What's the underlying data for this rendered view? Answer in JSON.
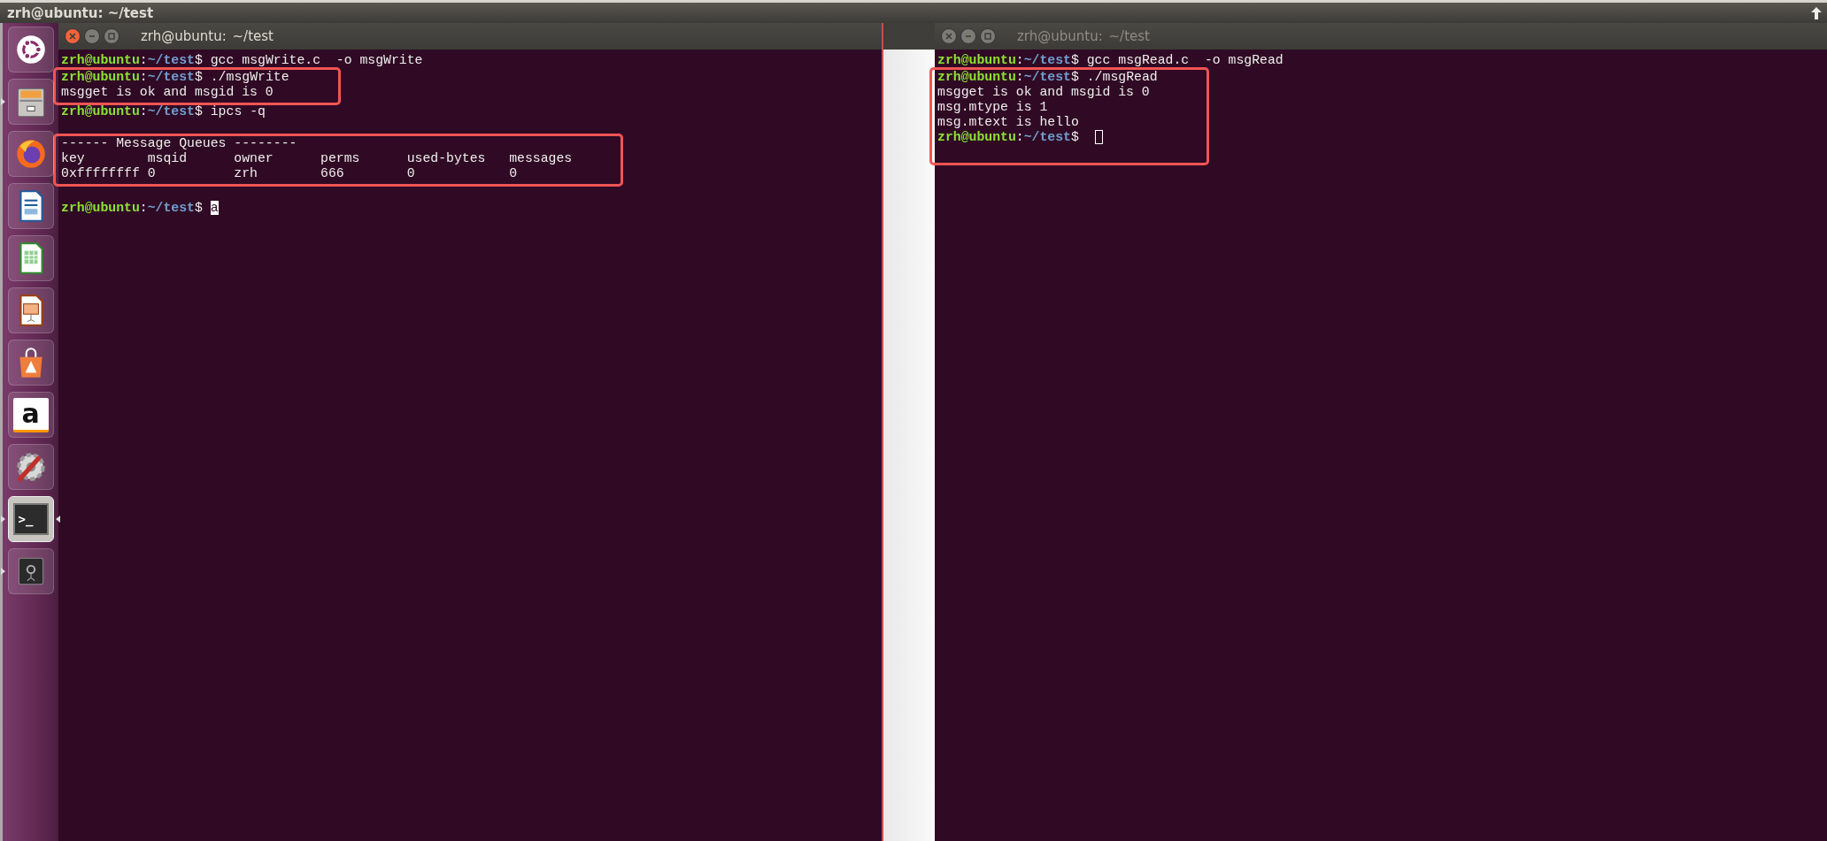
{
  "top_bar": {
    "title": "zrh@ubuntu: ~/test"
  },
  "launcher": {
    "items": [
      {
        "kind": "ubuntu",
        "running": false,
        "focused": false
      },
      {
        "kind": "files",
        "running": true,
        "focused": false
      },
      {
        "kind": "firefox",
        "running": false,
        "focused": false
      },
      {
        "kind": "writer",
        "running": false,
        "focused": false
      },
      {
        "kind": "calc",
        "running": false,
        "focused": false
      },
      {
        "kind": "impress",
        "running": false,
        "focused": false
      },
      {
        "kind": "software",
        "running": false,
        "focused": false
      },
      {
        "kind": "amazon",
        "label": "a",
        "running": false,
        "focused": false
      },
      {
        "kind": "settings",
        "running": false,
        "focused": false
      },
      {
        "kind": "terminal",
        "label": ">_",
        "running": true,
        "focused": true
      },
      {
        "kind": "disk",
        "running": true,
        "focused": false
      }
    ]
  },
  "windows": [
    {
      "title": "zrh@ubuntu: ~/test",
      "focused": true,
      "blocks": [
        {
          "highlighted": false,
          "lines": [
            {
              "kind": "prompt",
              "host": "zrh@ubuntu",
              "sep": ":",
              "path": "~/test",
              "symbol": "$",
              "command": "gcc msgWrite.c  -o msgWrite"
            }
          ]
        },
        {
          "highlighted": true,
          "lines": [
            {
              "kind": "prompt",
              "host": "zrh@ubuntu",
              "sep": ":",
              "path": "~/test",
              "symbol": "$",
              "command": "./msgWrite"
            },
            {
              "kind": "output",
              "text": "msgget is ok and msgid is 0"
            }
          ]
        },
        {
          "highlighted": false,
          "lines": [
            {
              "kind": "prompt",
              "host": "zrh@ubuntu",
              "sep": ":",
              "path": "~/test",
              "symbol": "$",
              "command": "ipcs -q"
            },
            {
              "kind": "blank"
            }
          ]
        },
        {
          "highlighted": true,
          "lines": [
            {
              "kind": "output",
              "text": "------ Message Queues --------"
            },
            {
              "kind": "output",
              "text": "key        msqid      owner      perms      used-bytes   messages"
            },
            {
              "kind": "output",
              "text": "0xffffffff 0          zrh        666        0            0"
            }
          ]
        },
        {
          "highlighted": false,
          "lines": [
            {
              "kind": "blank"
            },
            {
              "kind": "prompt",
              "host": "zrh@ubuntu",
              "sep": ":",
              "path": "~/test",
              "symbol": "$",
              "command": "a",
              "cursor": true
            }
          ]
        }
      ]
    },
    {
      "title": "zrh@ubuntu: ~/test",
      "focused": false,
      "blocks": [
        {
          "highlighted": false,
          "lines": [
            {
              "kind": "prompt",
              "host": "zrh@ubuntu",
              "sep": ":",
              "path": "~/test",
              "symbol": "$",
              "command": "gcc msgRead.c  -o msgRead"
            }
          ]
        },
        {
          "highlighted": true,
          "lines": [
            {
              "kind": "prompt",
              "host": "zrh@ubuntu",
              "sep": ":",
              "path": "~/test",
              "symbol": "$",
              "command": "./msgRead"
            },
            {
              "kind": "output",
              "text": "msgget is ok and msgid is 0"
            },
            {
              "kind": "output",
              "text": "msg.mtype is 1"
            },
            {
              "kind": "output",
              "text": "msg.mtext is hello"
            },
            {
              "kind": "prompt",
              "host": "zrh@ubuntu",
              "sep": ":",
              "path": "~/test",
              "symbol": "$",
              "cursor": true
            },
            {
              "kind": "blank"
            }
          ]
        }
      ]
    }
  ]
}
